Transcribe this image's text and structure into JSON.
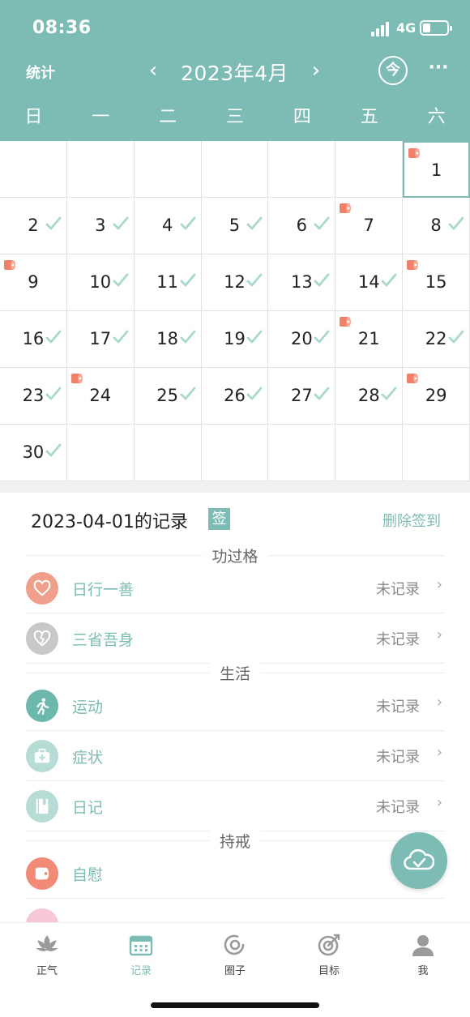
{
  "status_bar": {
    "time": "08:36",
    "network": "4G"
  },
  "header": {
    "stats_label": "统计",
    "month_title": "2023年4月",
    "today_label": "今",
    "more_label": "···",
    "weekdays": [
      "日",
      "一",
      "二",
      "三",
      "四",
      "五",
      "六"
    ]
  },
  "calendar": {
    "year": 2023,
    "month": 4,
    "selected_day": 1,
    "days": [
      {
        "day": "1",
        "checked": false,
        "tissue": true
      },
      {
        "day": "2",
        "checked": true,
        "tissue": false
      },
      {
        "day": "3",
        "checked": true,
        "tissue": false
      },
      {
        "day": "4",
        "checked": true,
        "tissue": false
      },
      {
        "day": "5",
        "checked": true,
        "tissue": false
      },
      {
        "day": "6",
        "checked": true,
        "tissue": false
      },
      {
        "day": "7",
        "checked": false,
        "tissue": true
      },
      {
        "day": "8",
        "checked": true,
        "tissue": false
      },
      {
        "day": "9",
        "checked": false,
        "tissue": true
      },
      {
        "day": "10",
        "checked": true,
        "tissue": false
      },
      {
        "day": "11",
        "checked": true,
        "tissue": false
      },
      {
        "day": "12",
        "checked": true,
        "tissue": false
      },
      {
        "day": "13",
        "checked": true,
        "tissue": false
      },
      {
        "day": "14",
        "checked": true,
        "tissue": false
      },
      {
        "day": "15",
        "checked": false,
        "tissue": true
      },
      {
        "day": "16",
        "checked": true,
        "tissue": false
      },
      {
        "day": "17",
        "checked": true,
        "tissue": false
      },
      {
        "day": "18",
        "checked": true,
        "tissue": false
      },
      {
        "day": "19",
        "checked": true,
        "tissue": false
      },
      {
        "day": "20",
        "checked": true,
        "tissue": false
      },
      {
        "day": "21",
        "checked": false,
        "tissue": true
      },
      {
        "day": "22",
        "checked": true,
        "tissue": false
      },
      {
        "day": "23",
        "checked": true,
        "tissue": false
      },
      {
        "day": "24",
        "checked": false,
        "tissue": true
      },
      {
        "day": "25",
        "checked": true,
        "tissue": false
      },
      {
        "day": "26",
        "checked": true,
        "tissue": false
      },
      {
        "day": "27",
        "checked": true,
        "tissue": false
      },
      {
        "day": "28",
        "checked": true,
        "tissue": false
      },
      {
        "day": "29",
        "checked": false,
        "tissue": true
      },
      {
        "day": "30",
        "checked": true,
        "tissue": false
      }
    ]
  },
  "records": {
    "title": "2023-04-01的记录",
    "sign_badge": "签",
    "delete_label": "删除签到",
    "sections": [
      {
        "name": "功过格",
        "items": [
          {
            "label": "日行一善",
            "status": "未记录",
            "icon": "heart-icon",
            "color": "#f0a08a"
          },
          {
            "label": "三省吾身",
            "status": "未记录",
            "icon": "broken-heart-icon",
            "color": "#c8c8c8"
          }
        ]
      },
      {
        "name": "生活",
        "items": [
          {
            "label": "运动",
            "status": "未记录",
            "icon": "running-icon",
            "color": "#6cb8ad"
          },
          {
            "label": "症状",
            "status": "未记录",
            "icon": "medical-kit-icon",
            "color": "#b7dcd6"
          },
          {
            "label": "日记",
            "status": "未记录",
            "icon": "notebook-icon",
            "color": "#b7dcd6"
          }
        ]
      },
      {
        "name": "持戒",
        "items": [
          {
            "label": "自慰",
            "status": "",
            "icon": "tissue-roll-icon",
            "color": "#f28b75"
          }
        ]
      }
    ]
  },
  "tabbar": {
    "tabs": [
      {
        "label": "正气",
        "icon": "lotus-icon",
        "active": false
      },
      {
        "label": "记录",
        "icon": "calendar-icon",
        "active": true
      },
      {
        "label": "圈子",
        "icon": "circle-icon",
        "active": false
      },
      {
        "label": "目标",
        "icon": "target-icon",
        "active": false
      },
      {
        "label": "我",
        "icon": "person-icon",
        "active": false
      }
    ]
  },
  "colors": {
    "accent": "#7cbcb4",
    "check": "#a9d8cf",
    "tissue": "#f0806a"
  }
}
